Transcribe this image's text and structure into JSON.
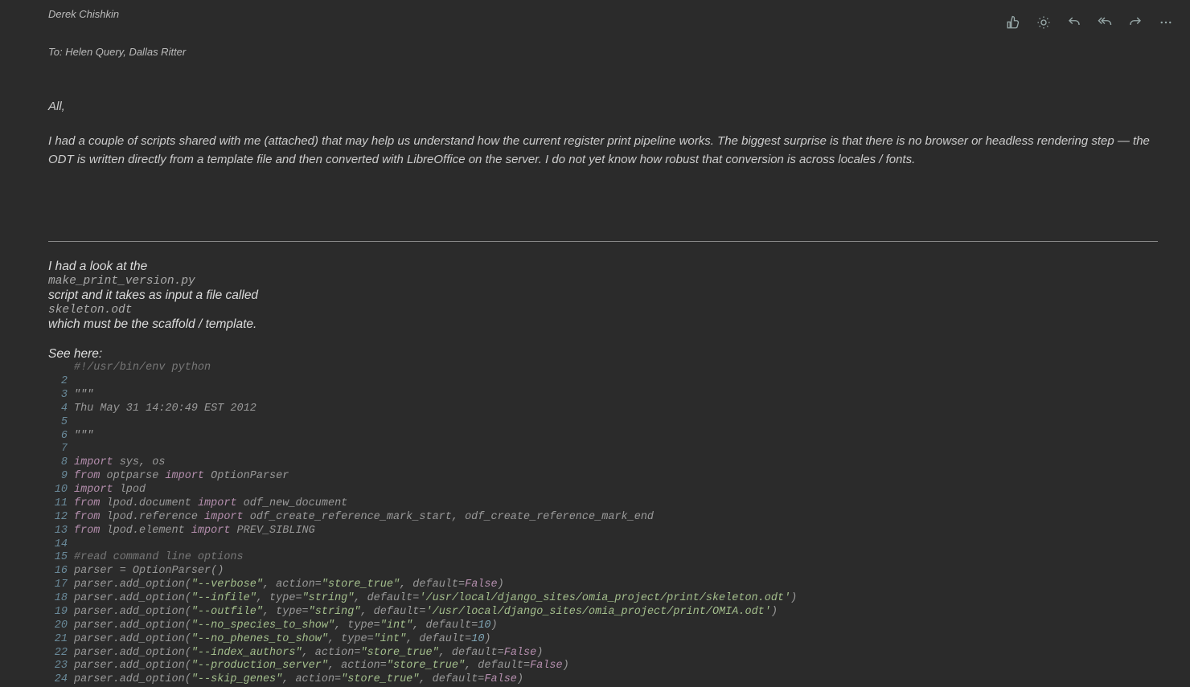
{
  "toolbar": {
    "thumbs_up": "thumbs-up-icon",
    "sun": "sun-icon",
    "undo": "undo-icon",
    "reply_all": "reply-all-icon",
    "forward": "forward-icon",
    "more": "more-icon"
  },
  "author": "Derek Chishkin",
  "to_label": "To: ",
  "recipients": "Helen Query, Dallas Ritter",
  "greeting": "All,",
  "intro": "I had a couple of scripts shared with me (attached) that may help us understand how the current register print pipeline works. The biggest surprise is that there is no browser or headless rendering step — the ODT is written directly from a template file and then converted with LibreOffice on the server. I do not yet know how robust that conversion is across locales / fonts.",
  "body": {
    "line1": "I had a look at the",
    "file1": "make_print_version.py",
    "line2": "script and it takes as input a file called",
    "file2": "skeleton.odt",
    "line3": "which must be the scaffold / template.",
    "see_here": "See here:"
  },
  "code": {
    "lines": [
      {
        "n": "",
        "html": "<span class='cmt'>#!/usr/bin/env python</span>"
      },
      {
        "n": "2",
        "html": ""
      },
      {
        "n": "3",
        "html": "\"\"\""
      },
      {
        "n": "4",
        "html": "Thu May 31 14:20:49 EST 2012"
      },
      {
        "n": "5",
        "html": ""
      },
      {
        "n": "6",
        "html": "\"\"\""
      },
      {
        "n": "7",
        "html": ""
      },
      {
        "n": "8",
        "html": "<span class='kw'>import</span> sys, os"
      },
      {
        "n": "9",
        "html": "<span class='kw'>from</span> optparse <span class='kw'>import</span> OptionParser"
      },
      {
        "n": "10",
        "html": "<span class='kw'>import</span> lpod"
      },
      {
        "n": "11",
        "html": "<span class='kw'>from</span> lpod.document <span class='kw'>import</span> odf_new_document"
      },
      {
        "n": "12",
        "html": "<span class='kw'>from</span> lpod.reference <span class='kw'>import</span> odf_create_reference_mark_start, odf_create_reference_mark_end"
      },
      {
        "n": "13",
        "html": "<span class='kw'>from</span> lpod.element <span class='kw'>import</span> PREV_SIBLING"
      },
      {
        "n": "14",
        "html": ""
      },
      {
        "n": "15",
        "html": "<span class='cmt'>#read command line options</span>"
      },
      {
        "n": "16",
        "html": "parser = OptionParser()"
      },
      {
        "n": "17",
        "html": "parser.add_option(<span class='str'>\"--verbose\"</span>, action=<span class='str'>\"store_true\"</span>, default=<span class='bool'>False</span>)"
      },
      {
        "n": "18",
        "html": "parser.add_option(<span class='str'>\"--infile\"</span>, type=<span class='str'>\"string\"</span>, default=<span class='str'>'/usr/local/django_sites/omia_project/print/skeleton.odt'</span>)"
      },
      {
        "n": "19",
        "html": "parser.add_option(<span class='str'>\"--outfile\"</span>, type=<span class='str'>\"string\"</span>, default=<span class='str'>'/usr/local/django_sites/omia_project/print/OMIA.odt'</span>)"
      },
      {
        "n": "20",
        "html": "parser.add_option(<span class='str'>\"--no_species_to_show\"</span>, type=<span class='str'>\"int\"</span>, default=<span class='num'>10</span>)"
      },
      {
        "n": "21",
        "html": "parser.add_option(<span class='str'>\"--no_phenes_to_show\"</span>, type=<span class='str'>\"int\"</span>, default=<span class='num'>10</span>)"
      },
      {
        "n": "22",
        "html": "parser.add_option(<span class='str'>\"--index_authors\"</span>, action=<span class='str'>\"store_true\"</span>, default=<span class='bool'>False</span>)"
      },
      {
        "n": "23",
        "html": "parser.add_option(<span class='str'>\"--production_server\"</span>, action=<span class='str'>\"store_true\"</span>, default=<span class='bool'>False</span>)"
      },
      {
        "n": "24",
        "html": "parser.add_option(<span class='str'>\"--skip_genes\"</span>, action=<span class='str'>\"store_true\"</span>, default=<span class='bool'>False</span>)"
      }
    ]
  }
}
